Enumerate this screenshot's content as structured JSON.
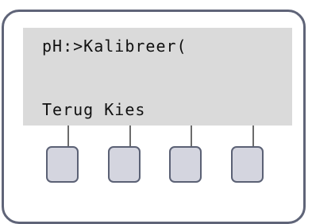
{
  "display": {
    "line1": "pH:>Kalibreer(",
    "line2": "Terug Kies"
  },
  "colors": {
    "lcd_background": "#dadada",
    "device_border": "#5f6478",
    "button_fill": "#d4d5df",
    "button_border": "#5b6175"
  }
}
